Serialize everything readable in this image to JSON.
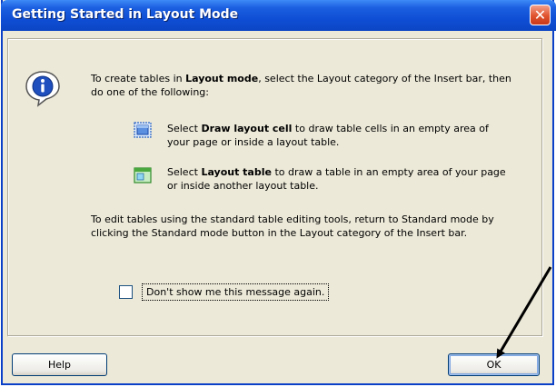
{
  "window": {
    "title": "Getting Started in Layout Mode",
    "close_glyph": "✕"
  },
  "message": {
    "intro_pre": "To create tables in ",
    "intro_bold": "Layout mode",
    "intro_post": ", select the Layout category of the Insert bar, then do one of the following:",
    "item1_pre": "Select ",
    "item1_bold": "Draw layout cell",
    "item1_post": " to draw table cells in an empty area of your page or inside a layout table.",
    "item2_pre": "Select ",
    "item2_bold": "Layout table",
    "item2_post": " to draw a table in an empty area of your page or inside another layout table.",
    "edit_text": "To edit tables using the standard table editing tools, return to Standard mode by clicking the Standard mode button in the Layout category of the Insert bar."
  },
  "checkbox": {
    "label": "Don't show me this message again.",
    "checked": false
  },
  "buttons": {
    "help": "Help",
    "ok": "OK"
  },
  "icons": {
    "info": "info-icon",
    "item1": "draw-layout-cell-icon",
    "item2": "layout-table-icon",
    "annotation": "arrow-pointer"
  },
  "colors": {
    "titlebar": "#0b45c4",
    "dialog_bg": "#ece9d8",
    "close_button": "#e0522d"
  }
}
